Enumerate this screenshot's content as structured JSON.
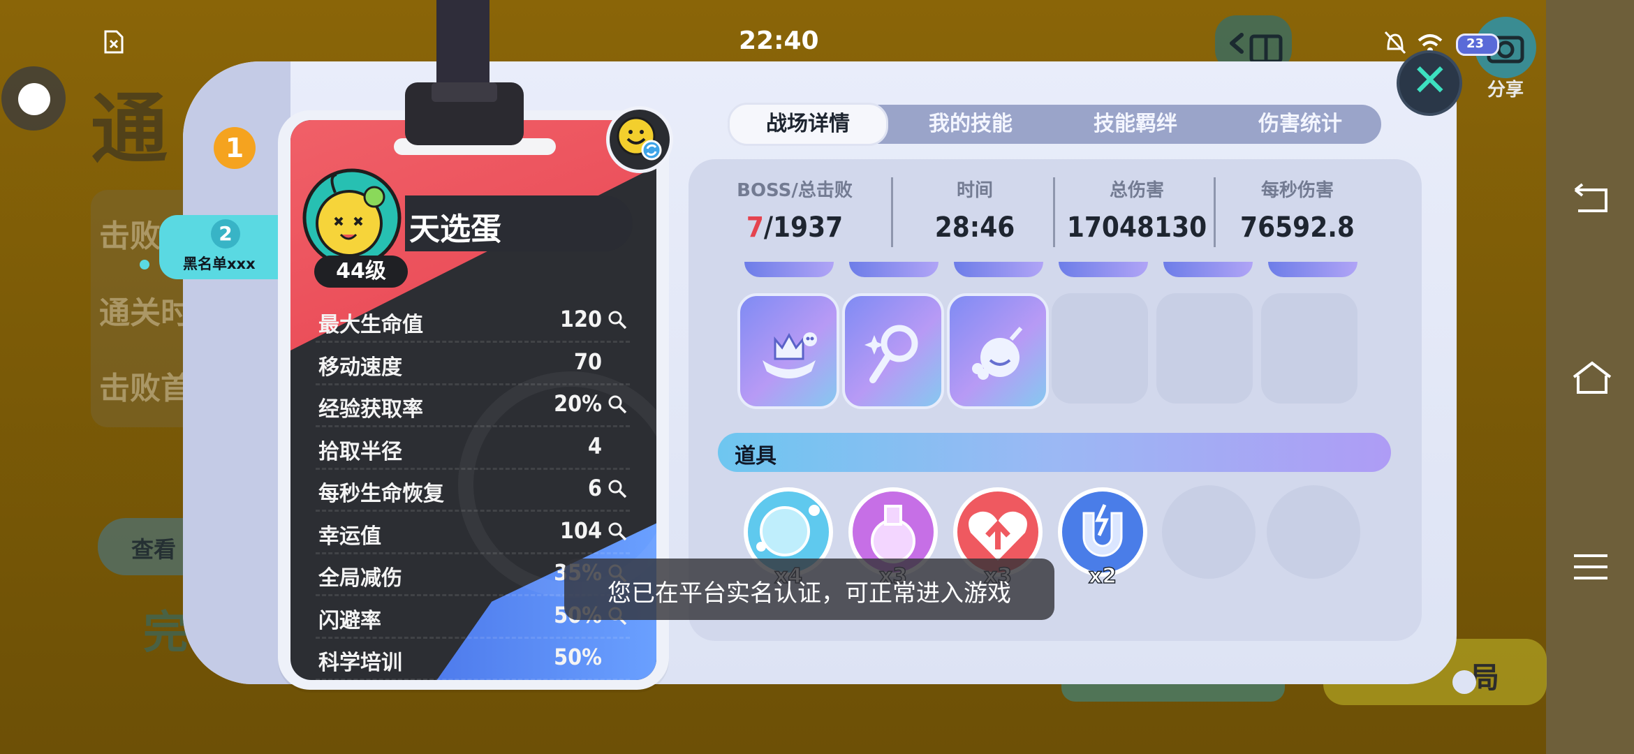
{
  "status_bar": {
    "time": "22:40",
    "battery": "23"
  },
  "background": {
    "title_fragment": "通",
    "rows": [
      "击败",
      "通关时",
      "击败首"
    ],
    "left_button_label": "查看",
    "big_text": "完",
    "bottom_button_label": "局",
    "share_label": "分享"
  },
  "players": [
    {
      "rank": "1"
    },
    {
      "rank": "2",
      "name": "黑名单xxx"
    }
  ],
  "character": {
    "name": "天选蛋",
    "level": "44级",
    "stats": [
      {
        "label": "最大生命值",
        "value": "120",
        "magnifier": true
      },
      {
        "label": "移动速度",
        "value": "70",
        "magnifier": false
      },
      {
        "label": "经验获取率",
        "value": "20%",
        "magnifier": true
      },
      {
        "label": "拾取半径",
        "value": "4",
        "magnifier": false
      },
      {
        "label": "每秒生命恢复",
        "value": "6",
        "magnifier": true
      },
      {
        "label": "幸运值",
        "value": "104",
        "magnifier": true
      },
      {
        "label": "全局减伤",
        "value": "35%",
        "magnifier": true
      },
      {
        "label": "闪避率",
        "value": "50%",
        "magnifier": true
      },
      {
        "label": "科学培训",
        "value": "50%",
        "magnifier": false
      }
    ]
  },
  "tabs": [
    {
      "label": "战场详情",
      "active": true
    },
    {
      "label": "我的技能",
      "active": false
    },
    {
      "label": "技能羁绊",
      "active": false
    },
    {
      "label": "伤害统计",
      "active": false
    }
  ],
  "summary": {
    "boss_label": "BOSS/总击败",
    "boss_killed": "7",
    "total_killed": "/1937",
    "time_label": "时间",
    "time_value": "28:46",
    "damage_label": "总伤害",
    "damage_value": "17048130",
    "dps_label": "每秒伤害",
    "dps_value": "76592.8"
  },
  "skills": [
    {
      "icon": "crown-skull-skill-icon",
      "filled": true
    },
    {
      "icon": "sparkle-wand-skill-icon",
      "filled": true
    },
    {
      "icon": "clover-bomb-skill-icon",
      "filled": true
    },
    {
      "filled": false
    },
    {
      "filled": false
    },
    {
      "filled": false
    }
  ],
  "items_section": {
    "title": "道具",
    "items": [
      {
        "icon": "bubble-icon",
        "count": "x4",
        "color": "#5fc9ee"
      },
      {
        "icon": "potion-icon",
        "count": "x3",
        "color": "#c66fe6"
      },
      {
        "icon": "heart-arrow-icon",
        "count": "x3",
        "color": "#ef5960"
      },
      {
        "icon": "magnet-icon",
        "count": "x2",
        "color": "#4a7de8"
      },
      {
        "empty": true
      },
      {
        "empty": true
      }
    ]
  },
  "toast": "您已在平台实名认证，可正常进入游戏"
}
